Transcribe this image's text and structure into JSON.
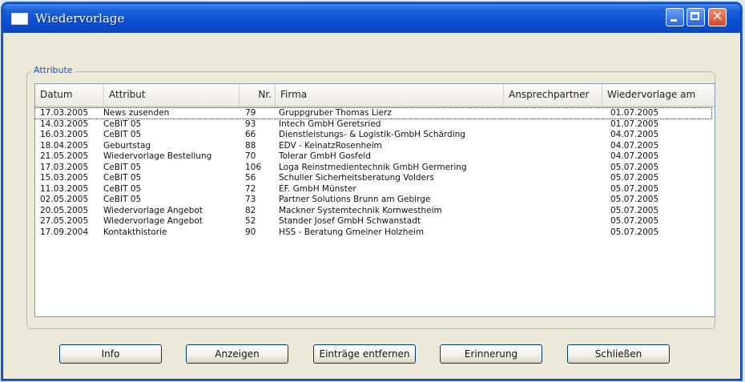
{
  "window": {
    "title": "Wiedervorlage"
  },
  "group": {
    "label": "Attribute"
  },
  "table": {
    "columns": [
      "Datum",
      "Attribut",
      "Nr.",
      "Firma",
      "Ansprechpartner",
      "Wiedervorlage am"
    ],
    "rows": [
      {
        "datum": "17.03.2005",
        "attribut": "News zusenden",
        "nr": "79",
        "firma": "Gruppgruber Thomas Lierz",
        "ansprechpartner": "",
        "wiedervorlage": "01.07.2005"
      },
      {
        "datum": "14.03.2005",
        "attribut": "CeBIT 05",
        "nr": "93",
        "firma": "Intech GmbH Geretsried",
        "ansprechpartner": "",
        "wiedervorlage": "01.07.2005"
      },
      {
        "datum": "16.03.2005",
        "attribut": "CeBIT 05",
        "nr": "66",
        "firma": "Dienstleistungs- & Logistik-GmbH Schärding",
        "ansprechpartner": "",
        "wiedervorlage": "04.07.2005"
      },
      {
        "datum": "18.04.2005",
        "attribut": "Geburtstag",
        "nr": "88",
        "firma": "EDV - KeinatzRosenheim",
        "ansprechpartner": "",
        "wiedervorlage": "04.07.2005"
      },
      {
        "datum": "21.05.2005",
        "attribut": "Wiedervorlage Bestellung",
        "nr": "70",
        "firma": "Tolerar GmbH Gosfeld",
        "ansprechpartner": "",
        "wiedervorlage": "04.07.2005"
      },
      {
        "datum": "17.03.2005",
        "attribut": "CeBIT 05",
        "nr": "106",
        "firma": "Loga Reinstmedientechnik GmbH Germering",
        "ansprechpartner": "",
        "wiedervorlage": "05.07.2005"
      },
      {
        "datum": "15.03.2005",
        "attribut": "CeBIT 05",
        "nr": "56",
        "firma": "Schuller Sicherheitsberatung Volders",
        "ansprechpartner": "",
        "wiedervorlage": "05.07.2005"
      },
      {
        "datum": "11.03.2005",
        "attribut": "CeBIT 05",
        "nr": "72",
        "firma": "EF. GmbH Münster",
        "ansprechpartner": "",
        "wiedervorlage": "05.07.2005"
      },
      {
        "datum": "02.05.2005",
        "attribut": "CeBIT 05",
        "nr": "73",
        "firma": "Partner Solutions Brunn am Gebirge",
        "ansprechpartner": "",
        "wiedervorlage": "05.07.2005"
      },
      {
        "datum": "20.05.2005",
        "attribut": "Wiedervorlage Angebot",
        "nr": "82",
        "firma": "Mackner Systemtechnik Kornwestheim",
        "ansprechpartner": "",
        "wiedervorlage": "05.07.2005"
      },
      {
        "datum": "27.05.2005",
        "attribut": "Wiedervorlage Angebot",
        "nr": "52",
        "firma": "Stander Josef GmbH Schwanstadt",
        "ansprechpartner": "",
        "wiedervorlage": "05.07.2005"
      },
      {
        "datum": "17.09.2004",
        "attribut": "Kontakthistorie",
        "nr": "90",
        "firma": "HSS - Beratung Gmeiner Holzheim",
        "ansprechpartner": "",
        "wiedervorlage": "05.07.2005"
      }
    ]
  },
  "buttons": {
    "info": "Info",
    "anzeigen": "Anzeigen",
    "entfernen": "Einträge entfernen",
    "erinnerung": "Erinnerung",
    "schliessen": "Schließen"
  }
}
